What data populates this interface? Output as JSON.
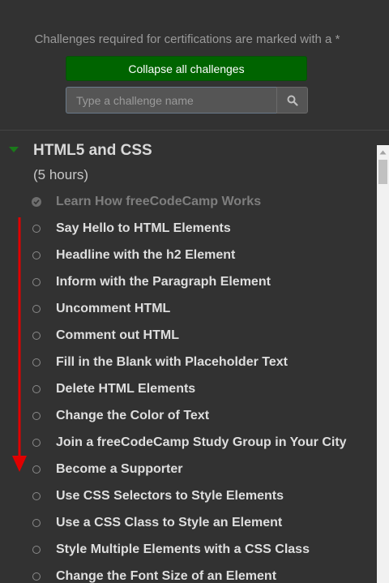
{
  "header": {
    "notice": "Challenges required for certifications are marked with a *",
    "collapse_label": "Collapse all challenges"
  },
  "search": {
    "placeholder": "Type a challenge name",
    "value": "",
    "icon": "search-icon"
  },
  "section": {
    "title": "HTML5 and CSS",
    "duration": "(5 hours)",
    "caret_color": "#1a7a1a",
    "expanded": true
  },
  "challenges": [
    {
      "label": "Learn How freeCodeCamp Works",
      "completed": true
    },
    {
      "label": "Say Hello to HTML Elements",
      "completed": false
    },
    {
      "label": "Headline with the h2 Element",
      "completed": false
    },
    {
      "label": "Inform with the Paragraph Element",
      "completed": false
    },
    {
      "label": "Uncomment HTML",
      "completed": false
    },
    {
      "label": "Comment out HTML",
      "completed": false
    },
    {
      "label": "Fill in the Blank with Placeholder Text",
      "completed": false
    },
    {
      "label": "Delete HTML Elements",
      "completed": false
    },
    {
      "label": "Change the Color of Text",
      "completed": false
    },
    {
      "label": "Join a freeCodeCamp Study Group in Your City",
      "completed": false
    },
    {
      "label": "Become a Supporter",
      "completed": false
    },
    {
      "label": "Use CSS Selectors to Style Elements",
      "completed": false
    },
    {
      "label": "Use a CSS Class to Style an Element",
      "completed": false
    },
    {
      "label": "Style Multiple Elements with a CSS Class",
      "completed": false
    },
    {
      "label": "Change the Font Size of an Element",
      "completed": false
    }
  ],
  "colors": {
    "background": "#323232",
    "button_green": "#006400",
    "annotation_arrow": "#e00000"
  }
}
